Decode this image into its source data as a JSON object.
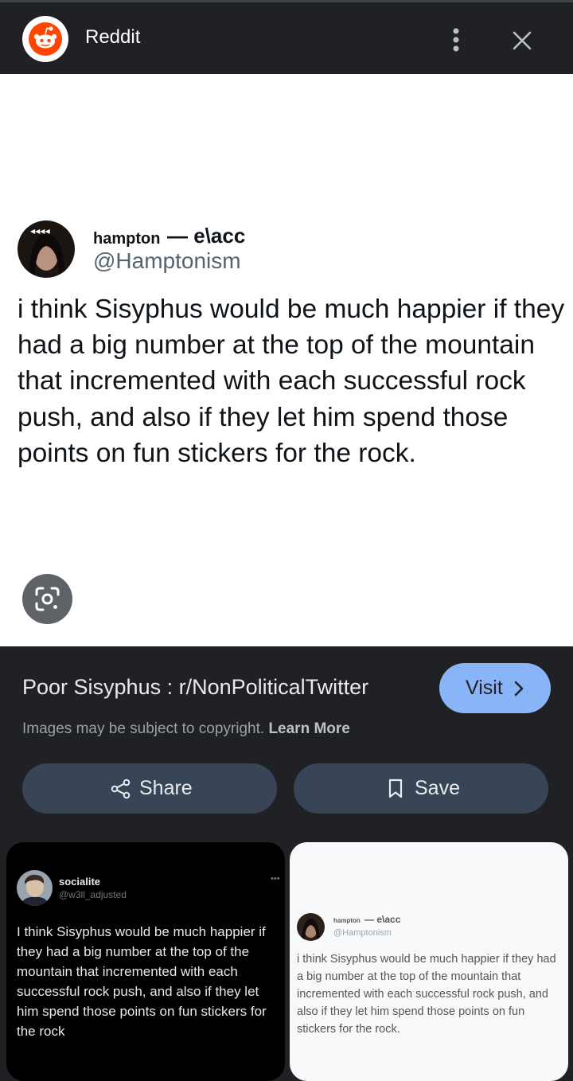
{
  "app": {
    "title": "Reddit"
  },
  "tweet": {
    "name": "hampton",
    "name_suffix": "— e\\acc",
    "handle": "@Hamptonism",
    "text": "i think Sisyphus would be much happier if they had a big number at the top of the mountain that incremented with each successful rock push, and also if they let him spend those points on fun stickers for the rock."
  },
  "result": {
    "title": "Poor Sisyphus : r/NonPoliticalTwitter",
    "visit_label": "Visit",
    "copyright_text": "Images may be subject to copyright.",
    "learn_more": "Learn More",
    "share_label": "Share",
    "save_label": "Save"
  },
  "related": [
    {
      "name": "socialite",
      "handle": "@w3ll_adjusted",
      "text": "I think Sisyphus would be much happier if they had a big number at the top of the mountain that incremented with each successful rock push, and also if they let him spend those points on fun stickers for the rock"
    },
    {
      "name": "hampton",
      "name_suffix": "— e\\acc",
      "handle": "@Hamptonism",
      "text": "i think Sisyphus would be much happier if they had a big number at the top of the mountain that incremented with each successful rock push, and also if they let him spend those points on fun stickers for the rock."
    }
  ],
  "icons": {
    "app_logo": "reddit-logo-icon",
    "menu": "more-vert-icon",
    "close": "close-icon",
    "lens": "google-lens-icon",
    "visit": "chevron-right-icon",
    "share": "share-icon",
    "save": "bookmark-icon"
  },
  "colors": {
    "accent": "#8ab4f8",
    "pill_bg": "#394457",
    "reddit_orange": "#ff4500"
  }
}
